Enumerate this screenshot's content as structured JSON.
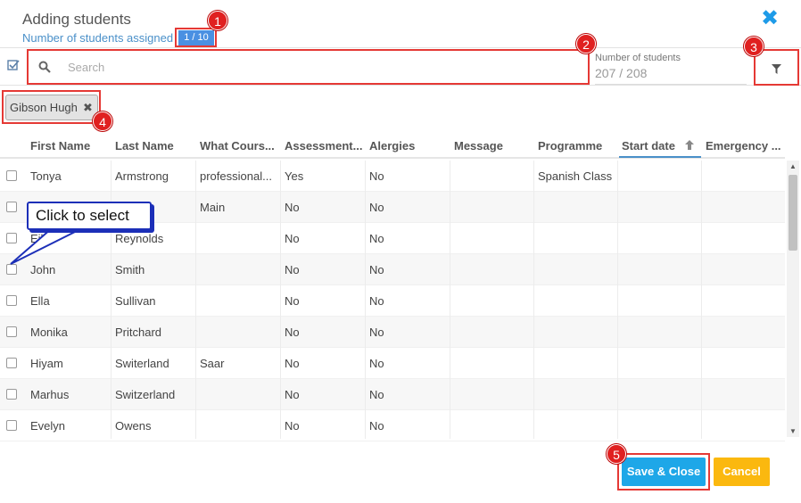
{
  "dialog": {
    "title": "Adding students",
    "assigned_label": "Number of students assigned",
    "assigned_value": "1 / 10"
  },
  "toolbar": {
    "search_placeholder": "Search",
    "count_label": "Number of students",
    "count_value": "207 / 208"
  },
  "chips": [
    {
      "label": "Gibson Hugh"
    }
  ],
  "table": {
    "columns": [
      "First Name",
      "Last Name",
      "What Cours...",
      "Assessment...",
      "Alergies",
      "Message",
      "Programme",
      "Start date",
      "Emergency ..."
    ],
    "rows": [
      [
        "Tonya",
        "Armstrong",
        "professional...",
        "Yes",
        "No",
        "",
        "Spanish Class",
        "",
        ""
      ],
      [
        "",
        "",
        "Main",
        "No",
        "No",
        "",
        "",
        "",
        ""
      ],
      [
        "Eil",
        "Reynolds",
        "",
        "No",
        "No",
        "",
        "",
        "",
        ""
      ],
      [
        "John",
        "Smith",
        "",
        "No",
        "No",
        "",
        "",
        "",
        ""
      ],
      [
        "Ella",
        "Sullivan",
        "",
        "No",
        "No",
        "",
        "",
        "",
        ""
      ],
      [
        "Monika",
        "Pritchard",
        "",
        "No",
        "No",
        "",
        "",
        "",
        ""
      ],
      [
        "Hiyam",
        "Switerland",
        "Saar",
        "No",
        "No",
        "",
        "",
        "",
        ""
      ],
      [
        "Marhus",
        "Switzerland",
        "",
        "No",
        "No",
        "",
        "",
        "",
        ""
      ],
      [
        "Evelyn",
        "Owens",
        "",
        "No",
        "No",
        "",
        "",
        "",
        ""
      ]
    ]
  },
  "buttons": {
    "save": "Save & Close",
    "cancel": "Cancel"
  },
  "annotations": {
    "markers": [
      "1",
      "2",
      "3",
      "4",
      "5"
    ],
    "callout": "Click to select"
  },
  "colors": {
    "accent": "#1ea7e8",
    "cancel": "#fbb80f",
    "highlight": "#e53935",
    "callout_border": "#1c2fb8"
  }
}
